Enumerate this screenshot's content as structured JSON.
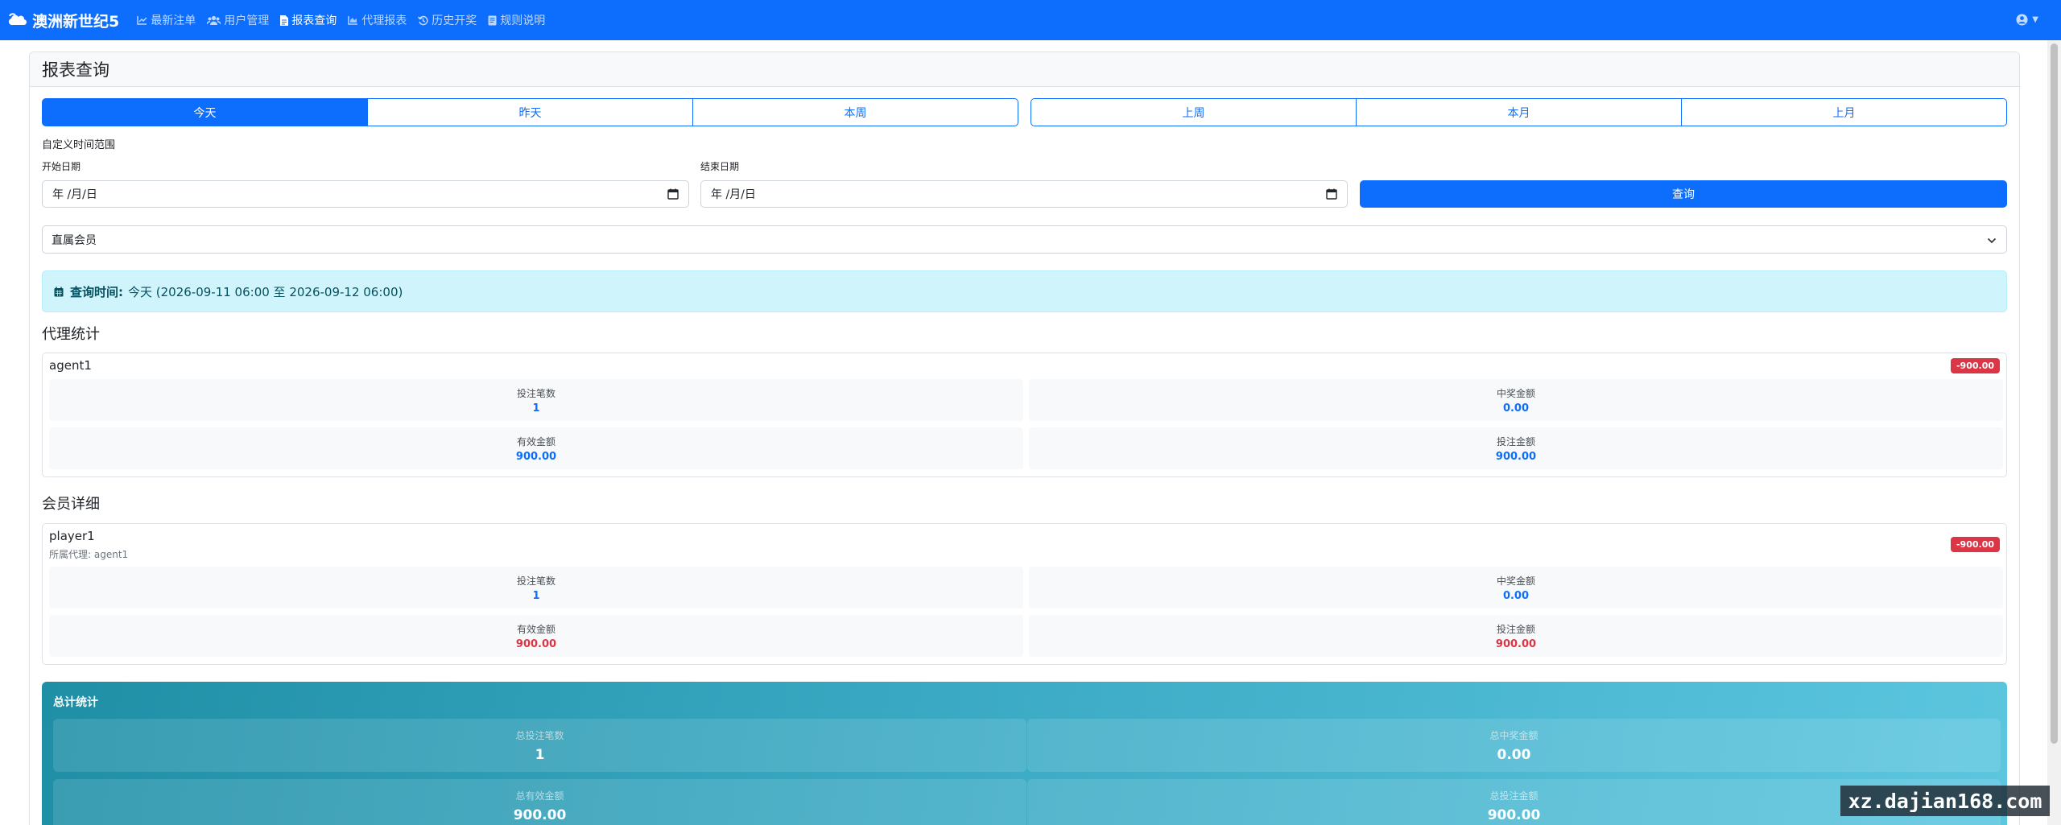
{
  "brand": {
    "name": "澳洲新世纪5",
    "icon": "cloud-bubble-icon"
  },
  "nav": {
    "items": [
      {
        "label": "最新注单",
        "icon": "line-chart-icon",
        "active": false
      },
      {
        "label": "用户管理",
        "icon": "users-icon",
        "active": false
      },
      {
        "label": "报表查询",
        "icon": "file-icon",
        "active": true
      },
      {
        "label": "代理报表",
        "icon": "area-chart-icon",
        "active": false
      },
      {
        "label": "历史开奖",
        "icon": "history-icon",
        "active": false
      },
      {
        "label": "规则说明",
        "icon": "book-icon",
        "active": false
      }
    ]
  },
  "user_menu": {
    "icon": "user-circle-icon"
  },
  "page": {
    "title": "报表查询"
  },
  "ranges": {
    "group1": [
      "今天",
      "昨天",
      "本周"
    ],
    "group2": [
      "上周",
      "本月",
      "上月"
    ],
    "active": "今天"
  },
  "custom_range": {
    "title": "自定义时间范围",
    "start_label": "开始日期",
    "end_label": "结束日期",
    "start_placeholder": "年 /月/日",
    "end_placeholder": "年 /月/日",
    "query_label": "查询"
  },
  "member_select": {
    "selected": "直属会员"
  },
  "query_time": {
    "label": "查询时间:",
    "value": "今天 (2026-09-11 06:00 至 2026-09-12 06:00)"
  },
  "agent_section": {
    "title": "代理统计",
    "entries": [
      {
        "name": "agent1",
        "badge": "-900.00",
        "stats": [
          {
            "label": "投注笔数",
            "value": "1"
          },
          {
            "label": "中奖金额",
            "value": "0.00"
          },
          {
            "label": "有效金额",
            "value": "900.00"
          },
          {
            "label": "投注金额",
            "value": "900.00"
          }
        ]
      }
    ]
  },
  "member_section": {
    "title": "会员详细",
    "entries": [
      {
        "name": "player1",
        "agent_line": "所属代理: agent1",
        "badge": "-900.00",
        "stats": [
          {
            "label": "投注笔数",
            "value": "1"
          },
          {
            "label": "中奖金额",
            "value": "0.00"
          },
          {
            "label": "有效金额",
            "value": "900.00"
          },
          {
            "label": "投注金额",
            "value": "900.00"
          }
        ]
      }
    ]
  },
  "summary": {
    "title": "总计统计",
    "stats": [
      {
        "label": "总投注笔数",
        "value": "1"
      },
      {
        "label": "总中奖金额",
        "value": "0.00"
      },
      {
        "label": "总有效金额",
        "value": "900.00"
      },
      {
        "label": "总投注金额",
        "value": "900.00"
      }
    ]
  },
  "watermark": "xz.dajian168.com",
  "colors": {
    "primary": "#0d6efd",
    "danger": "#dc3545",
    "info_bg": "#cff4fc",
    "summary": "#2aa0bb"
  }
}
